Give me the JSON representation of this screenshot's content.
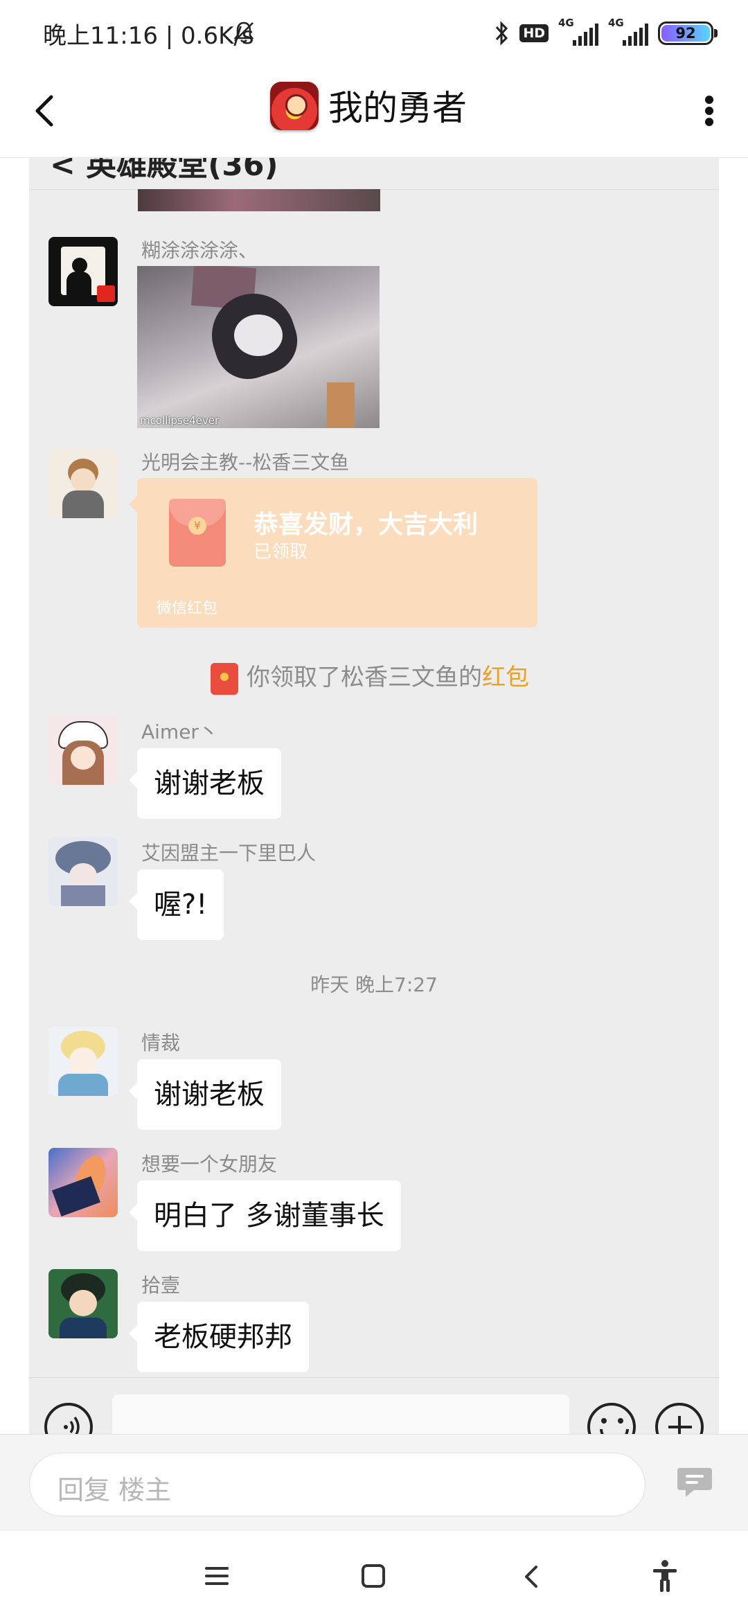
{
  "status_bar": {
    "time_speed": "晚上11:16 | 0.6K/s",
    "hd": "HD",
    "sim1": "4G",
    "sim2": "4G",
    "battery": "92"
  },
  "header": {
    "title": "我的勇者"
  },
  "chat": {
    "partial_title": "<  英雄殿堂(36)",
    "messages": [
      {
        "sender": "糊涂涂涂涂、",
        "type": "image",
        "watermark": "mcollipse4ever"
      },
      {
        "sender": "光明会主教--松香三文鱼",
        "type": "red_packet"
      },
      {
        "sender": "Aimer丶",
        "text": "谢谢老板"
      },
      {
        "sender": "艾因盟主一下里巴人",
        "text": "喔?!"
      },
      {
        "sender": "情裁",
        "text": "谢谢老板"
      },
      {
        "sender": "想要一个女朋友",
        "text": "明白了 多谢董事长"
      },
      {
        "sender": "拾壹",
        "text": "老板硬邦邦"
      }
    ],
    "red_packet": {
      "title": "恭喜发财，大吉大利",
      "status": "已领取",
      "footer": "微信红包",
      "coin": "¥"
    },
    "system_msg": {
      "prefix": "你领取了松香三文鱼的",
      "highlight": "红包"
    },
    "time_separator": "昨天 晚上7:27"
  },
  "reply": {
    "placeholder": "回复  楼主"
  },
  "colors": {
    "chat_bg": "#ededed",
    "red_packet_bg": "#fbdcbd",
    "highlight": "#f0a020"
  }
}
